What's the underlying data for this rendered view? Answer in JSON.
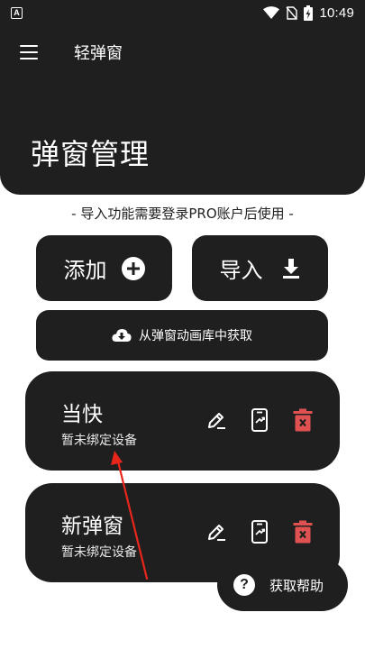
{
  "status_bar": {
    "app_icon_letter": "A",
    "time": "10:49",
    "icons": [
      "app-notification-icon",
      "wifi-icon",
      "no-sim-icon",
      "battery-charging-icon"
    ]
  },
  "header": {
    "app_title": "轻弹窗",
    "page_title": "弹窗管理"
  },
  "notice": "- 导入功能需要登录PRO账户后使用 -",
  "buttons": {
    "add": "添加",
    "import": "导入",
    "gallery": "从弹窗动画库中获取"
  },
  "cards": [
    {
      "title": "当快",
      "subtitle": "暂未绑定设备"
    },
    {
      "title": "新弹窗",
      "subtitle": "暂未绑定设备"
    }
  ],
  "fab": {
    "label": "获取帮助",
    "icon_glyph": "?"
  },
  "colors": {
    "surface": "#1f1f1f",
    "delete": "#e05252",
    "annotation": "#e8261c"
  }
}
